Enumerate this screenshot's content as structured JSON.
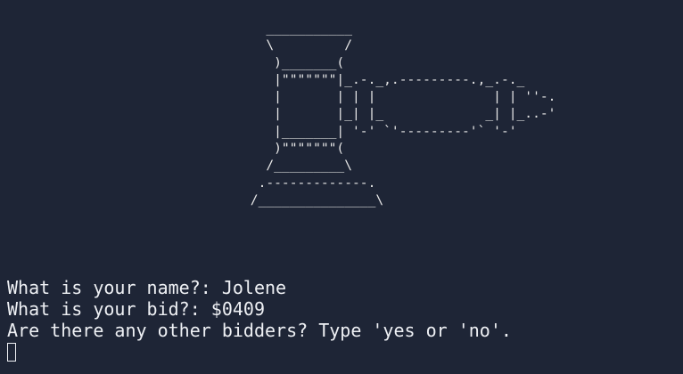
{
  "ascii_art": [
    "   ___________",
    "   \\         /",
    "    )_______(",
    "    |\"\"\"\"\"\"\"|_.-._,.---------.,_.-._",
    "    |       | | |               | | ''-.",
    "    |       |_| |_             _| |_..-'",
    "    |_______| '-' `'---------'` '-'",
    "    )\"\"\"\"\"\"\"(",
    "   /_________\\",
    "  .-------------.",
    " /_______________\\"
  ],
  "prompts": {
    "name_question": "What is your name?: ",
    "name_answer": "Jolene",
    "bid_question": "What is your bid?: ",
    "bid_answer": "$0409",
    "bidders_question": "Are there any other bidders? Type 'yes or 'no'."
  }
}
